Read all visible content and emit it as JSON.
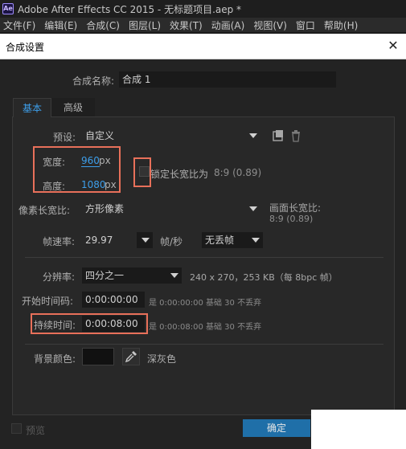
{
  "app": {
    "logo": "Ae",
    "title": "Adobe After Effects CC 2015 - 无标题项目.aep *"
  },
  "menu": [
    "文件(F)",
    "编辑(E)",
    "合成(C)",
    "图层(L)",
    "效果(T)",
    "动画(A)",
    "视图(V)",
    "窗口",
    "帮助(H)"
  ],
  "dialog": {
    "title": "合成设置",
    "close_symbol": "✕"
  },
  "comp_name": {
    "label": "合成名称:",
    "value": "合成 1"
  },
  "tabs": {
    "basic": "基本",
    "advanced": "高级"
  },
  "preset": {
    "label": "预设:",
    "value": "自定义"
  },
  "width": {
    "label": "宽度:",
    "value": "960",
    "unit": "px"
  },
  "height": {
    "label": "高度:",
    "value": "1080",
    "unit": "px"
  },
  "lock_aspect": {
    "label": "锁定长宽比为",
    "ratio": "8:9 (0.89)"
  },
  "pixel_aspect": {
    "label": "像素长宽比:",
    "value": "方形像素",
    "frame_label": "画面长宽比:",
    "frame_value": "8:9 (0.89)"
  },
  "frame_rate": {
    "label": "帧速率:",
    "value": "29.97",
    "unit": "帧/秒",
    "mode": "无丢帧"
  },
  "resolution": {
    "label": "分辨率:",
    "value": "四分之一",
    "info": "240 x 270，253 KB（每 8bpc 帧）"
  },
  "start_timecode": {
    "label": "开始时间码:",
    "value": "0:00:00:00",
    "info": "是 0:00:00:00  基础 30  不丢弃"
  },
  "duration": {
    "label": "持续时间:",
    "value": "0:00:08:00",
    "info": "是 0:00:08:00  基础 30  不丢弃"
  },
  "background": {
    "label": "背景颜色:",
    "color_name": "深灰色",
    "swatch_color": "#111111"
  },
  "footer": {
    "preview_label": "预览",
    "ok_label": "确定"
  },
  "colors": {
    "accent": "#3d9eea",
    "highlight": "#e8705a",
    "ok_bg": "#1f6fa8"
  }
}
